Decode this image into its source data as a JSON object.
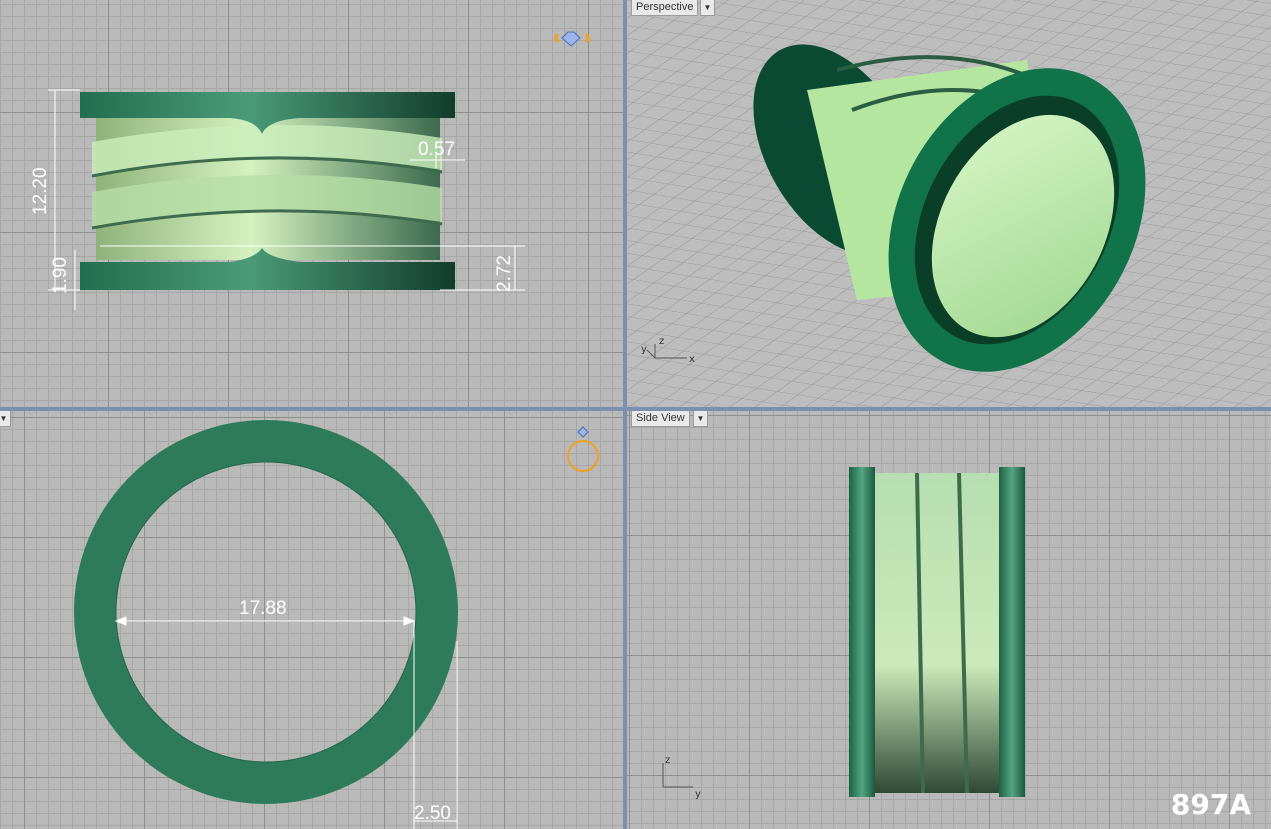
{
  "viewports": {
    "front": {
      "label": ""
    },
    "perspective": {
      "label": "Perspective"
    },
    "top": {
      "label": ""
    },
    "side": {
      "label": "Side View"
    }
  },
  "dimensions": {
    "height_total": "12.20",
    "gap_width": "0.57",
    "rail_bottom": "1.90",
    "rail_spacing": "2.72",
    "inner_diameter": "17.88",
    "wall_thickness": "2.50"
  },
  "axes": {
    "x": "x",
    "y": "y",
    "z": "z"
  },
  "watermark": "897A",
  "colors": {
    "ring_dark": "#1f6f4c",
    "ring_light": "#c3ecb4",
    "ring_mid": "#2e7b5c",
    "gizmo": "#f0a020",
    "grid_bg": "#b9b9b9"
  }
}
